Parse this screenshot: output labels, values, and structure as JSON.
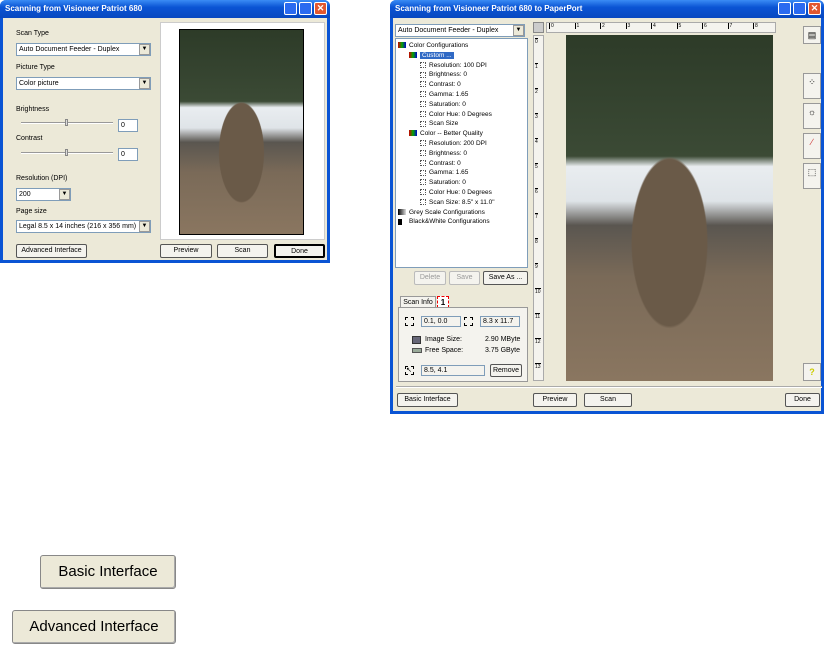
{
  "basic_dialog": {
    "title": "Scanning from Visioneer Patriot 680",
    "scan_type_label": "Scan Type",
    "scan_type_value": "Auto Document Feeder - Duplex",
    "picture_type_label": "Picture Type",
    "picture_type_value": "Color picture",
    "brightness_label": "Brightness",
    "brightness_value": "0",
    "brightness_level": 0.5,
    "contrast_label": "Contrast",
    "contrast_value": "0",
    "contrast_level": 0.5,
    "resolution_label": "Resolution (DPI)",
    "resolution_value": "200",
    "page_size_label": "Page size",
    "page_size_value": "Legal 8.5 x 14 inches (216 x 356 mm)",
    "advanced_button": "Advanced Interface",
    "preview_button": "Preview",
    "scan_button": "Scan",
    "done_button": "Done"
  },
  "advanced_dialog": {
    "title": "Scanning from Visioneer Patriot 680 to PaperPort",
    "scan_type_value": "Auto Document Feeder - Duplex",
    "tree": [
      {
        "label": "Color Configurations",
        "level": 0,
        "icon": "color-config-icon"
      },
      {
        "label": "Custom ...",
        "level": 1,
        "icon": "color-preset-icon",
        "selected": true
      },
      {
        "label": "Resolution: 100 DPI",
        "level": 2,
        "icon": "resolution-icon"
      },
      {
        "label": "Brightness: 0",
        "level": 2,
        "icon": "brightness-icon"
      },
      {
        "label": "Contrast: 0",
        "level": 2,
        "icon": "contrast-icon"
      },
      {
        "label": "Gamma: 1.65",
        "level": 2,
        "icon": "gamma-icon"
      },
      {
        "label": "Saturation: 0",
        "level": 2,
        "icon": "saturation-icon"
      },
      {
        "label": "Color Hue: 0 Degrees",
        "level": 2,
        "icon": "hue-icon"
      },
      {
        "label": "Scan Size",
        "level": 2,
        "icon": "scan-size-icon"
      },
      {
        "label": "Color -- Better Quality",
        "level": 1,
        "icon": "color-preset-icon"
      },
      {
        "label": "Resolution: 200 DPI",
        "level": 2,
        "icon": "resolution-icon"
      },
      {
        "label": "Brightness: 0",
        "level": 2,
        "icon": "brightness-icon"
      },
      {
        "label": "Contrast: 0",
        "level": 2,
        "icon": "contrast-icon"
      },
      {
        "label": "Gamma: 1.65",
        "level": 2,
        "icon": "gamma-icon"
      },
      {
        "label": "Saturation: 0",
        "level": 2,
        "icon": "saturation-icon"
      },
      {
        "label": "Color Hue: 0 Degrees",
        "level": 2,
        "icon": "hue-icon"
      },
      {
        "label": "Scan Size: 8.5\" x 11.0\"",
        "level": 2,
        "icon": "scan-size-icon"
      },
      {
        "label": "Grey Scale Configurations",
        "level": 0,
        "icon": "grey-config-icon"
      },
      {
        "label": "Black&White Configurations",
        "level": 0,
        "icon": "bw-config-icon"
      }
    ],
    "delete_button": "Delete",
    "save_button": "Save",
    "save_as_button": "Save As ...",
    "tab_scan_info": "Scan Info",
    "tab_page": "1",
    "origin_value": "0.1, 0.0",
    "size_value": "8.3 x 11.7",
    "image_size_label": "Image Size:",
    "image_size_value": "2.90 MByte",
    "free_space_label": "Free Space:",
    "free_space_value": "3.75 GByte",
    "cursor_value": "8.5, 4.1",
    "remove_button": "Remove",
    "ruler_top": [
      "0",
      "1",
      "2",
      "3",
      "4",
      "5",
      "6",
      "7",
      "8"
    ],
    "ruler_left": [
      "0",
      "1",
      "2",
      "3",
      "4",
      "5",
      "6",
      "7",
      "8",
      "9",
      "10",
      "11",
      "12",
      "13"
    ],
    "basic_button": "Basic Interface",
    "preview_button": "Preview",
    "scan_button": "Scan",
    "done_button": "Done"
  },
  "callouts": {
    "basic_interface": "Basic Interface",
    "advanced_interface": "Advanced Interface"
  }
}
